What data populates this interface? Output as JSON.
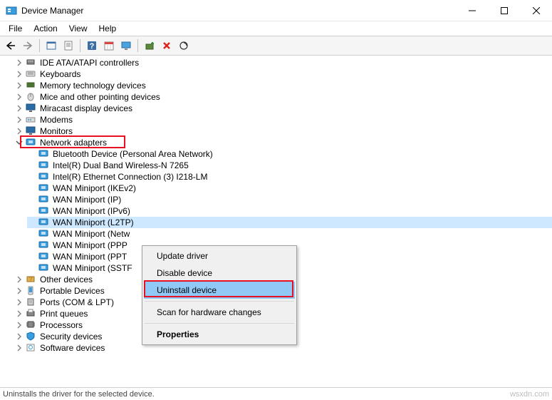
{
  "window": {
    "title": "Device Manager"
  },
  "menu": {
    "items": [
      "File",
      "Action",
      "View",
      "Help"
    ]
  },
  "toolbar": {
    "buttons": [
      {
        "name": "back-icon",
        "glyph": "arrow-left"
      },
      {
        "name": "forward-icon",
        "glyph": "arrow-right"
      },
      {
        "name": "show-hidden-icon",
        "glyph": "window"
      },
      {
        "name": "properties-icon",
        "glyph": "properties"
      },
      {
        "name": "help-icon",
        "glyph": "help"
      },
      {
        "name": "calendar-icon",
        "glyph": "calendar"
      },
      {
        "name": "monitor-icon",
        "glyph": "monitor"
      },
      {
        "name": "add-hardware-icon",
        "glyph": "add-hardware"
      },
      {
        "name": "delete-icon",
        "glyph": "delete-x"
      },
      {
        "name": "scan-hardware-icon",
        "glyph": "scan"
      }
    ]
  },
  "tree": {
    "top_nodes": [
      {
        "label": "IDE ATA/ATAPI controllers",
        "icon": "ide",
        "expanded": false
      },
      {
        "label": "Keyboards",
        "icon": "keyboard",
        "expanded": false
      },
      {
        "label": "Memory technology devices",
        "icon": "memory",
        "expanded": false
      },
      {
        "label": "Mice and other pointing devices",
        "icon": "mouse",
        "expanded": false
      },
      {
        "label": "Miracast display devices",
        "icon": "monitor",
        "expanded": false
      },
      {
        "label": "Modems",
        "icon": "modem",
        "expanded": false
      },
      {
        "label": "Monitors",
        "icon": "monitor",
        "expanded": false
      }
    ],
    "network_adapters": {
      "label": "Network adapters",
      "icon": "network",
      "expanded": true,
      "children": [
        {
          "label": "Bluetooth Device (Personal Area Network)",
          "icon": "network"
        },
        {
          "label": "Intel(R) Dual Band Wireless-N 7265",
          "icon": "network"
        },
        {
          "label": "Intel(R) Ethernet Connection (3) I218-LM",
          "icon": "network"
        },
        {
          "label": "WAN Miniport (IKEv2)",
          "icon": "network"
        },
        {
          "label": "WAN Miniport (IP)",
          "icon": "network"
        },
        {
          "label": "WAN Miniport (IPv6)",
          "icon": "network"
        },
        {
          "label": "WAN Miniport (L2TP)",
          "icon": "network",
          "selected": true
        },
        {
          "label": "WAN Miniport (Network Monitor)",
          "icon": "network",
          "truncated": "WAN Miniport (Netw"
        },
        {
          "label": "WAN Miniport (PPPOE)",
          "icon": "network",
          "truncated": "WAN Miniport (PPP"
        },
        {
          "label": "WAN Miniport (PPTP)",
          "icon": "network",
          "truncated": "WAN Miniport (PPT"
        },
        {
          "label": "WAN Miniport (SSTP)",
          "icon": "network",
          "truncated": "WAN Miniport (SSTF"
        }
      ]
    },
    "bottom_nodes": [
      {
        "label": "Other devices",
        "icon": "other",
        "expanded": false
      },
      {
        "label": "Portable Devices",
        "icon": "portable",
        "expanded": false
      },
      {
        "label": "Ports (COM & LPT)",
        "icon": "ports",
        "expanded": false
      },
      {
        "label": "Print queues",
        "icon": "printer",
        "expanded": false
      },
      {
        "label": "Processors",
        "icon": "cpu",
        "expanded": false
      },
      {
        "label": "Security devices",
        "icon": "security",
        "expanded": false
      },
      {
        "label": "Software devices",
        "icon": "software",
        "expanded": false
      }
    ]
  },
  "context_menu": {
    "items": [
      {
        "label": "Update driver",
        "bold": false
      },
      {
        "label": "Disable device",
        "bold": false
      },
      {
        "label": "Uninstall device",
        "bold": false,
        "highlighted": true
      },
      {
        "sep": true
      },
      {
        "label": "Scan for hardware changes",
        "bold": false
      },
      {
        "sep": true
      },
      {
        "label": "Properties",
        "bold": true
      }
    ]
  },
  "status": {
    "text": "Uninstalls the driver for the selected device.",
    "watermark": "wsxdn.com"
  }
}
